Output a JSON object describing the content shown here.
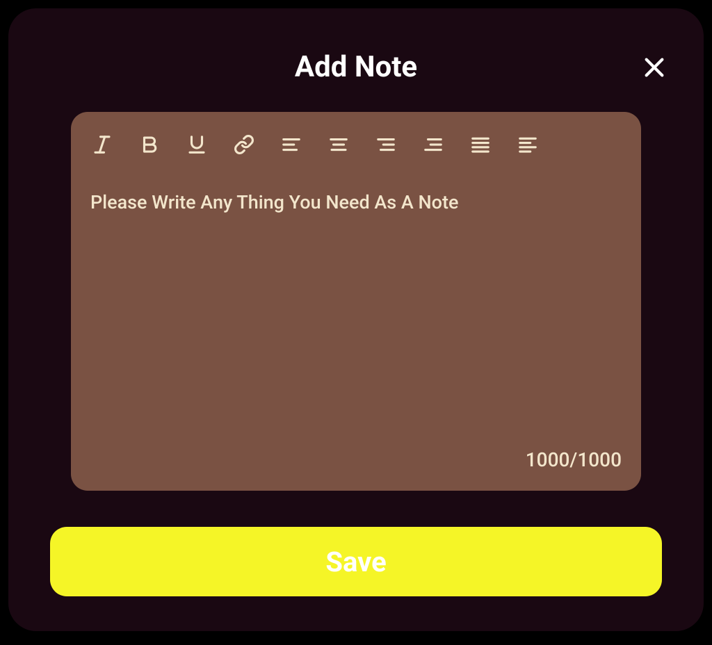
{
  "modal": {
    "title": "Add Note"
  },
  "editor": {
    "placeholder": "Please Write Any Thing You Need As A Note",
    "value": "",
    "char_counter": "1000/1000"
  },
  "toolbar": {
    "italic": "italic",
    "bold": "bold",
    "underline": "underline",
    "link": "link",
    "align_left": "align-left",
    "align_center": "align-center",
    "align_right": "align-right",
    "align_justify_right": "align-justify-right",
    "align_justify": "align-justify",
    "align_left_alt": "align-left-alt"
  },
  "buttons": {
    "save": "Save"
  }
}
